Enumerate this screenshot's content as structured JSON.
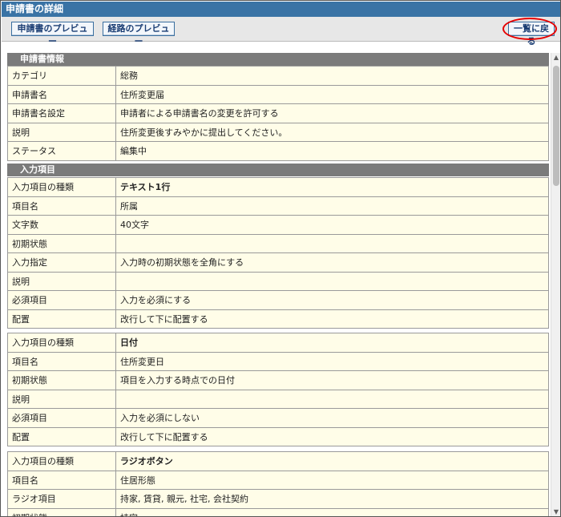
{
  "title": "申請書の詳細",
  "toolbar": {
    "preview_form": "申請書のプレビュー",
    "preview_route": "経路のプレビュー",
    "back": "一覧に戻る"
  },
  "info": {
    "header": "申請書情報",
    "rows": [
      {
        "label": "カテゴリ",
        "value": "総務"
      },
      {
        "label": "申請書名",
        "value": "住所変更届"
      },
      {
        "label": "申請書名設定",
        "value": "申請者による申請書名の変更を許可する"
      },
      {
        "label": "説明",
        "value": "住所変更後すみやかに提出してください。"
      },
      {
        "label": "ステータス",
        "value": "編集中"
      }
    ]
  },
  "fields": {
    "header": "入力項目",
    "groups": [
      {
        "rows": [
          {
            "label": "入力項目の種類",
            "value": "テキスト1行"
          },
          {
            "label": "項目名",
            "value": "所属"
          },
          {
            "label": "文字数",
            "value": "40文字"
          },
          {
            "label": "初期状態",
            "value": ""
          },
          {
            "label": "入力指定",
            "value": "入力時の初期状態を全角にする"
          },
          {
            "label": "説明",
            "value": ""
          },
          {
            "label": "必須項目",
            "value": "入力を必須にする"
          },
          {
            "label": "配置",
            "value": "改行して下に配置する"
          }
        ]
      },
      {
        "rows": [
          {
            "label": "入力項目の種類",
            "value": "日付"
          },
          {
            "label": "項目名",
            "value": "住所変更日"
          },
          {
            "label": "初期状態",
            "value": "項目を入力する時点での日付"
          },
          {
            "label": "説明",
            "value": ""
          },
          {
            "label": "必須項目",
            "value": "入力を必須にしない"
          },
          {
            "label": "配置",
            "value": "改行して下に配置する"
          }
        ]
      },
      {
        "rows": [
          {
            "label": "入力項目の種類",
            "value": "ラジオボタン"
          },
          {
            "label": "項目名",
            "value": "住居形態"
          },
          {
            "label": "ラジオ項目",
            "value": "持家, 賃貸, 親元, 社宅, 会社契約"
          },
          {
            "label": "初期状態",
            "value": "持家"
          }
        ]
      }
    ]
  }
}
